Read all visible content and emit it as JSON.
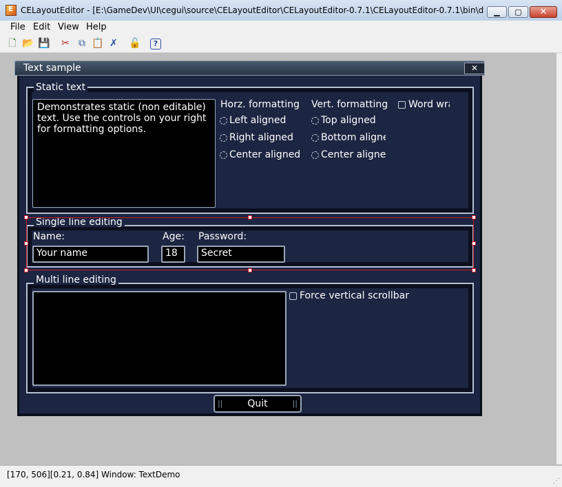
{
  "window": {
    "title": "CELayoutEditor - [E:\\GameDev\\UI\\cegui\\source\\CELayoutEditor\\CELayoutEditor-0.7.1\\CELayoutEditor-0.7.1\\bin\\dat...",
    "min": "▁",
    "max": "▢",
    "close": "✕"
  },
  "menu": [
    "File",
    "Edit",
    "View",
    "Help"
  ],
  "toolbar": [
    {
      "icon": "new-icon",
      "glyph": "🗋"
    },
    {
      "icon": "open-icon",
      "glyph": "📂"
    },
    {
      "icon": "save-icon",
      "glyph": "💾"
    },
    {
      "icon": "cut-icon",
      "glyph": "✂"
    },
    {
      "icon": "copy-icon",
      "glyph": "⧉"
    },
    {
      "icon": "paste-icon",
      "glyph": "📋"
    },
    {
      "icon": "delete-icon",
      "glyph": "✗"
    },
    {
      "icon": "lock-icon",
      "glyph": "🔓"
    },
    {
      "icon": "help-icon",
      "glyph": "?"
    }
  ],
  "cegui": {
    "title": "Text sample",
    "close": "✕",
    "static": {
      "label": "Static text",
      "text": "Demonstrates static (non editable) text. Use the controls on your right for formatting options.",
      "horz_header": "Horz. formatting",
      "vert_header": "Vert. formatting",
      "word_wrap": "Word wra",
      "horz": [
        "Left aligned",
        "Right aligned",
        "Center aligned"
      ],
      "vert": [
        "Top aligned",
        "Bottom aligne",
        "Center alignec"
      ]
    },
    "single": {
      "label": "Single line editing",
      "name_label": "Name:",
      "age_label": "Age:",
      "password_label": "Password:",
      "name_value": "Your name",
      "age_value": "18",
      "password_value": "Secret"
    },
    "multi": {
      "label": "Multi line editing",
      "force_scrollbar": "Force vertical scrollbar"
    },
    "quit": "Quit"
  },
  "status": "[170, 506][0.21, 0.84] Window: TextDemo",
  "status_grip": "⋰"
}
